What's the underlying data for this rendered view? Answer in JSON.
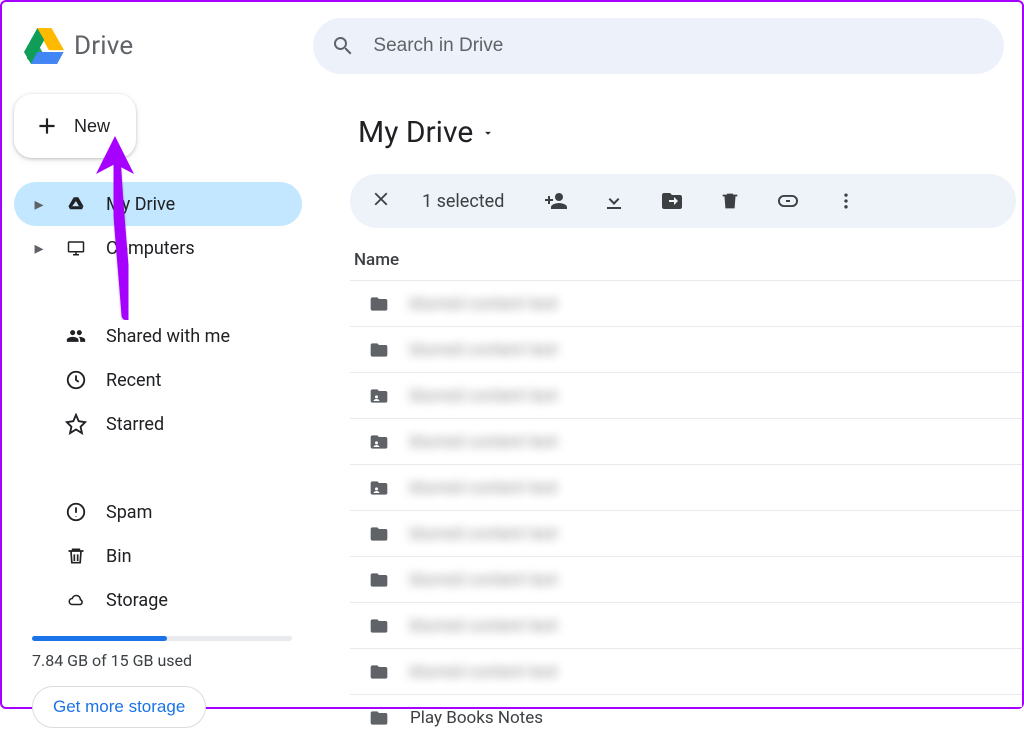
{
  "app_name": "Drive",
  "search": {
    "placeholder": "Search in Drive"
  },
  "new_button": "New",
  "sidebar": {
    "items": [
      {
        "label": "My Drive"
      },
      {
        "label": "Computers"
      },
      {
        "label": "Shared with me"
      },
      {
        "label": "Recent"
      },
      {
        "label": "Starred"
      },
      {
        "label": "Spam"
      },
      {
        "label": "Bin"
      },
      {
        "label": "Storage"
      }
    ],
    "storage_used_label": "7.84 GB of 15 GB used",
    "storage_percent": 52,
    "get_more_label": "Get more storage"
  },
  "main": {
    "title": "My Drive",
    "selection_label": "1 selected",
    "column_header": "Name",
    "rows": [
      {
        "label": "",
        "kind": "folder",
        "blurred": true
      },
      {
        "label": "",
        "kind": "folder",
        "blurred": true
      },
      {
        "label": "",
        "kind": "shared-folder",
        "blurred": true
      },
      {
        "label": "",
        "kind": "shared-folder",
        "blurred": true
      },
      {
        "label": "",
        "kind": "shared-folder",
        "blurred": true
      },
      {
        "label": "",
        "kind": "folder",
        "blurred": true
      },
      {
        "label": "",
        "kind": "folder",
        "blurred": true
      },
      {
        "label": "",
        "kind": "folder",
        "blurred": true
      },
      {
        "label": "",
        "kind": "folder",
        "blurred": true
      },
      {
        "label": "Play Books Notes",
        "kind": "folder",
        "blurred": false
      }
    ]
  }
}
